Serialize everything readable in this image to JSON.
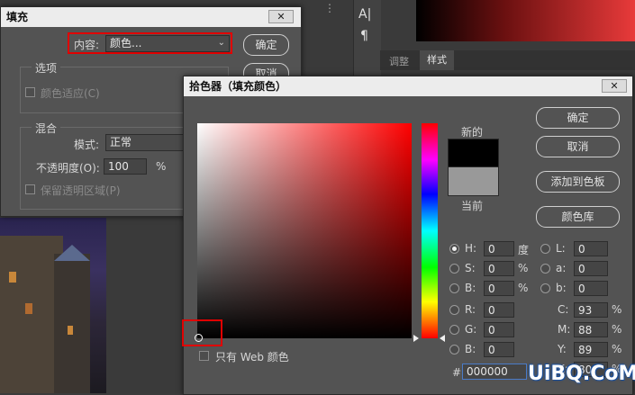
{
  "fill_dialog": {
    "title": "填充",
    "close": "✕",
    "content_label": "内容:",
    "content_value": "颜色...",
    "ok": "确定",
    "cancel": "取消",
    "options_section": "选项",
    "color_adapt": "颜色适应(C)",
    "blend_section": "混合",
    "mode_label": "模式:",
    "mode_value": "正常",
    "opacity_label": "不透明度(O):",
    "opacity_value": "100",
    "opacity_unit": "%",
    "preserve": "保留透明区域(P)"
  },
  "background_panel": {
    "tab_adjust": "调整",
    "tab_styles": "样式",
    "text_tool": "A|",
    "para_tool": "¶"
  },
  "picker": {
    "title": "拾色器（填充颜色）",
    "close": "✕",
    "new_label": "新的",
    "current_label": "当前",
    "new_color": "#000000",
    "current_color": "#999999",
    "hue_color": "#ff0000",
    "ok": "确定",
    "cancel": "取消",
    "add_swatch": "添加到色板",
    "color_libs": "颜色库",
    "only_web": "只有 Web 颜色",
    "fields": {
      "H": {
        "label": "H:",
        "value": "0",
        "unit": "度"
      },
      "S": {
        "label": "S:",
        "value": "0",
        "unit": "%"
      },
      "B": {
        "label": "B:",
        "value": "0",
        "unit": "%"
      },
      "R": {
        "label": "R:",
        "value": "0"
      },
      "G": {
        "label": "G:",
        "value": "0"
      },
      "Bl": {
        "label": "B:",
        "value": "0"
      },
      "L": {
        "label": "L:",
        "value": "0"
      },
      "a": {
        "label": "a:",
        "value": "0"
      },
      "b": {
        "label": "b:",
        "value": "0"
      },
      "C": {
        "label": "C:",
        "value": "93",
        "unit": "%"
      },
      "M": {
        "label": "M:",
        "value": "88",
        "unit": "%"
      },
      "Y": {
        "label": "Y:",
        "value": "89",
        "unit": "%"
      },
      "K": {
        "label": "K:",
        "value": "80",
        "unit": "%"
      }
    },
    "hex_label": "#",
    "hex_value": "000000"
  },
  "watermark": "UiBQ.CoM"
}
